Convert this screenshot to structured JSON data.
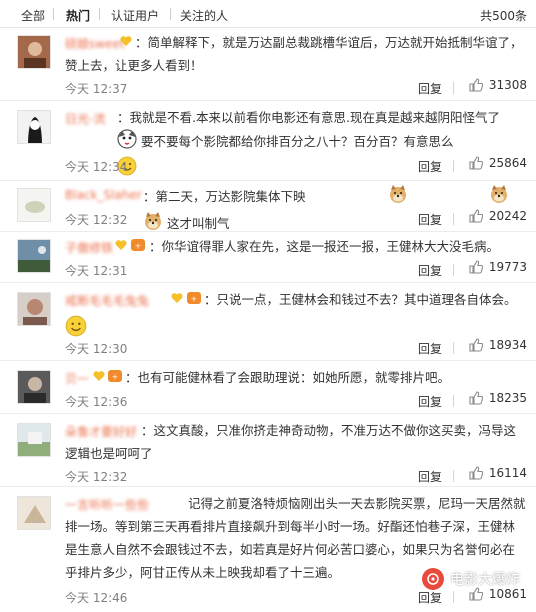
{
  "tabs": {
    "all": "全部",
    "hot": "热门",
    "verified": "认证用户",
    "following": "关注的人",
    "total": "共500条"
  },
  "actions": {
    "reply": "回复"
  },
  "accent": "#eb7350",
  "comments": [
    {
      "username": "硕娘sweet",
      "text": "：简单解释下，就是万达副总裁跳槽华谊后，万达就开始抵制华谊了，赞上去，让更多人看到！",
      "time": "今天 12:37",
      "likes": "31308"
    },
    {
      "username": "日光-流",
      "text_a": "：我就是不看.本来以前看你电影还有意思.现在真是越来越阴阳怪气了",
      "text_b": "要不要每个影院都给你排百分之八十？百分百？有意思么",
      "time": "今天 12:34",
      "likes": "25864"
    },
    {
      "username": "Black_Slaher",
      "text_a": "：第二天，万达影院集体下映",
      "text_b": "这才叫制气",
      "time": "今天 12:32",
      "likes": "20242"
    },
    {
      "username": "子傲修铁",
      "text": "：你华谊得罪人家在先，这是一报还一报，王健林大大没毛病。",
      "time": "今天 12:31",
      "likes": "19773"
    },
    {
      "username": "戒断毛毛毛兔兔",
      "text": "：只说一点，王健林会和钱过不去？其中道理各自体会。",
      "time": "今天 12:30",
      "likes": "18934"
    },
    {
      "username": "贝一",
      "text": "：也有可能健林看了会跟助理说：如她所愿，就零排片吧。",
      "time": "今天 12:36",
      "likes": "18235"
    },
    {
      "username": "朵鲁才要好好",
      "text": "：这文真酸，只准你挤走神奇动物，不准万达不做你这买卖，冯导这逻辑也是呵呵了",
      "time": "今天 12:32",
      "likes": "16114"
    },
    {
      "username": "一言听听一些些",
      "text": "记得之前夏洛特烦恼刚出头一天去影院买票，尼玛一天居然就排一场。等到第三天再看排片直接飙升到每半小时一场。好酯还怕巷子深，王健林是生意人自然不会跟钱过不去，如若真是好片何必苦口婆心，如果只为名誉何必在乎排片多少，阿甘正传从未上映我却看了十三遍。",
      "time": "今天 12:46",
      "likes": "10861"
    }
  ],
  "watermark": {
    "label": "电影大爆炸"
  }
}
